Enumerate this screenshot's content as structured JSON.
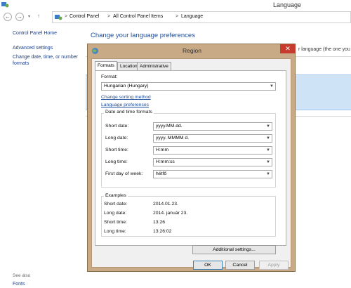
{
  "window": {
    "title": "Language"
  },
  "breadcrumb": {
    "items": [
      "Control Panel",
      "All Control Panel Items",
      "Language"
    ],
    "separator": ">"
  },
  "nav": {
    "back_icon": "back-arrow-icon",
    "forward_icon": "forward-arrow-icon",
    "up_icon": "up-arrow-icon"
  },
  "sidebar": {
    "links": [
      "Control Panel Home",
      "Advanced settings",
      "Change date, time, or number formats"
    ],
    "see_also_label": "See also",
    "see_also_links": [
      "Fonts"
    ]
  },
  "main": {
    "title": "Change your language preferences",
    "partial_text": "r language (the one you"
  },
  "dialog": {
    "title": "Region",
    "close_label": "✕",
    "tabs": [
      "Formats",
      "Location",
      "Administrative"
    ],
    "active_tab": "Formats",
    "format_label": "Format:",
    "format_value": "Hungarian (Hungary)",
    "link_sorting": "Change sorting method",
    "link_language": "Language preferences",
    "datetime_group": "Date and time formats",
    "fields": [
      {
        "label": "Short date:",
        "value": "yyyy.MM.dd."
      },
      {
        "label": "Long date:",
        "value": "yyyy. MMMM d."
      },
      {
        "label": "Short time:",
        "value": "H:mm"
      },
      {
        "label": "Long time:",
        "value": "H:mm:ss"
      },
      {
        "label": "First day of week:",
        "value": "hétfő"
      }
    ],
    "examples_group": "Examples",
    "examples": [
      {
        "label": "Short date:",
        "value": "2014.01.23."
      },
      {
        "label": "Long date:",
        "value": "2014. január 23."
      },
      {
        "label": "Short time:",
        "value": "13:26"
      },
      {
        "label": "Long time:",
        "value": "13:26:02"
      }
    ],
    "additional_button": "Additional settings...",
    "ok_button": "OK",
    "cancel_button": "Cancel",
    "apply_button": "Apply",
    "colors": {
      "frame": "#c8aa86",
      "close": "#c83a2d",
      "link": "#1a4a9a"
    }
  }
}
